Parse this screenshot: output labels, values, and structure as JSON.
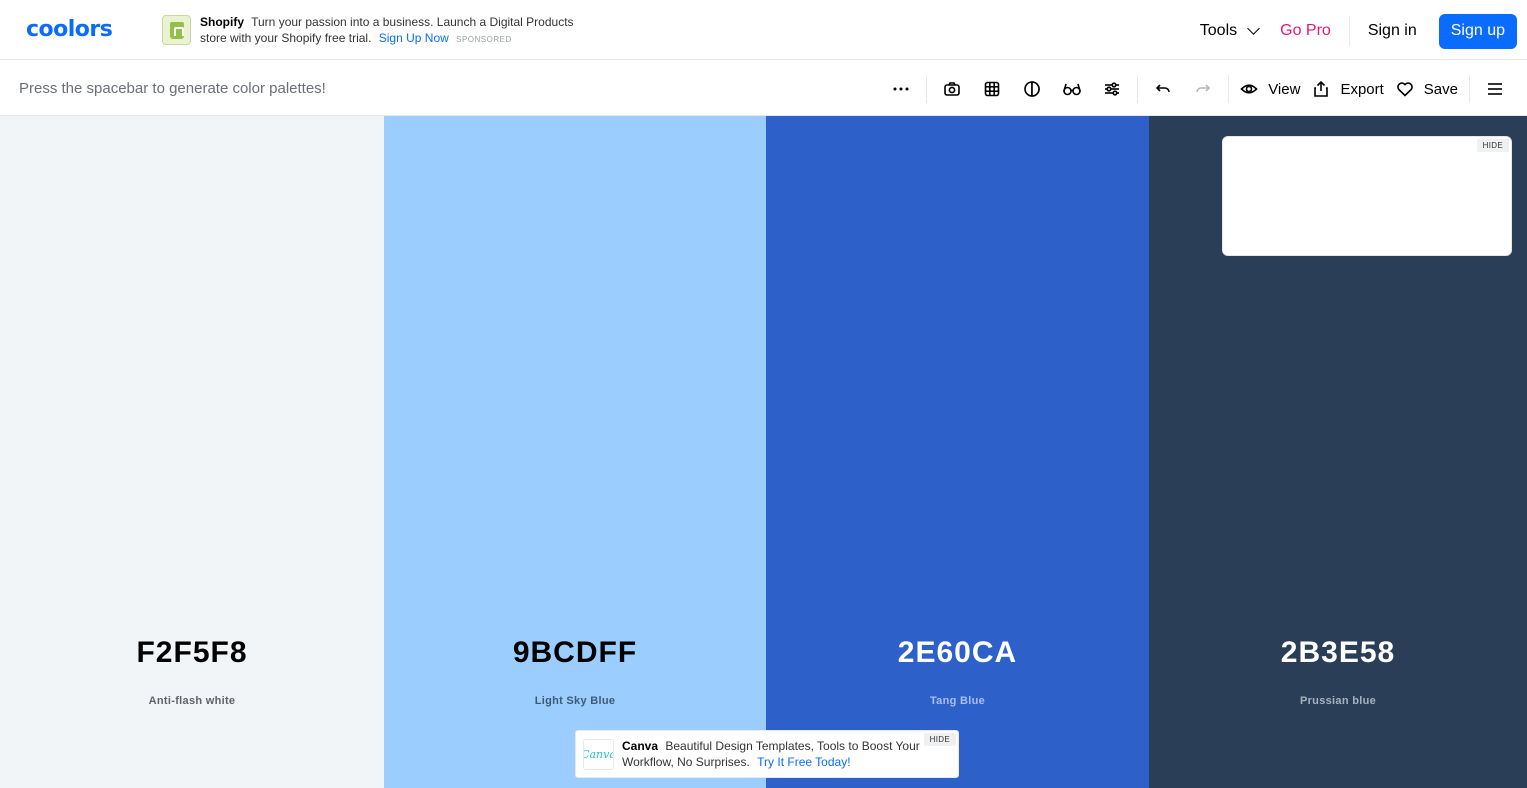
{
  "nav": {
    "logo": "coolors",
    "ad": {
      "brand": "Shopify",
      "text": "Turn your passion into a business. Launch a Digital Products store with your Shopify free trial.",
      "cta": "Sign Up Now",
      "sponsored": "SPONSORED"
    },
    "tools_label": "Tools",
    "gopro_label": "Go Pro",
    "signin_label": "Sign in",
    "signup_label": "Sign up"
  },
  "toolbar": {
    "hint": "Press the spacebar to generate color palettes!",
    "view_label": "View",
    "export_label": "Export",
    "save_label": "Save"
  },
  "palette": [
    {
      "hex": "F2F5F8",
      "name": "Anti-flash white",
      "color": "#F2F5F8",
      "text_color": "#000000",
      "name_color": "#5f6368"
    },
    {
      "hex": "9BCDFF",
      "name": "Light Sky Blue",
      "color": "#9BCDFF",
      "text_color": "#000000",
      "name_color": "#3f5a74"
    },
    {
      "hex": "2E60CA",
      "name": "Tang Blue",
      "color": "#2E60CA",
      "text_color": "#FFFFFF",
      "name_color": "#a9bfea"
    },
    {
      "hex": "2B3E58",
      "name": "Prussian blue",
      "color": "#2B3E58",
      "text_color": "#FFFFFF",
      "name_color": "#a7b1c0"
    }
  ],
  "ads": {
    "side_hide": "HIDE",
    "bottom": {
      "logo": "Canva",
      "brand": "Canva",
      "text": "Beautiful Design Templates, Tools to Boost Your Workflow, No Surprises.",
      "cta": "Try It Free Today!",
      "hide": "HIDE"
    }
  },
  "colors": {
    "accent": "#0A6CFF",
    "gopro": "#E5177E"
  }
}
